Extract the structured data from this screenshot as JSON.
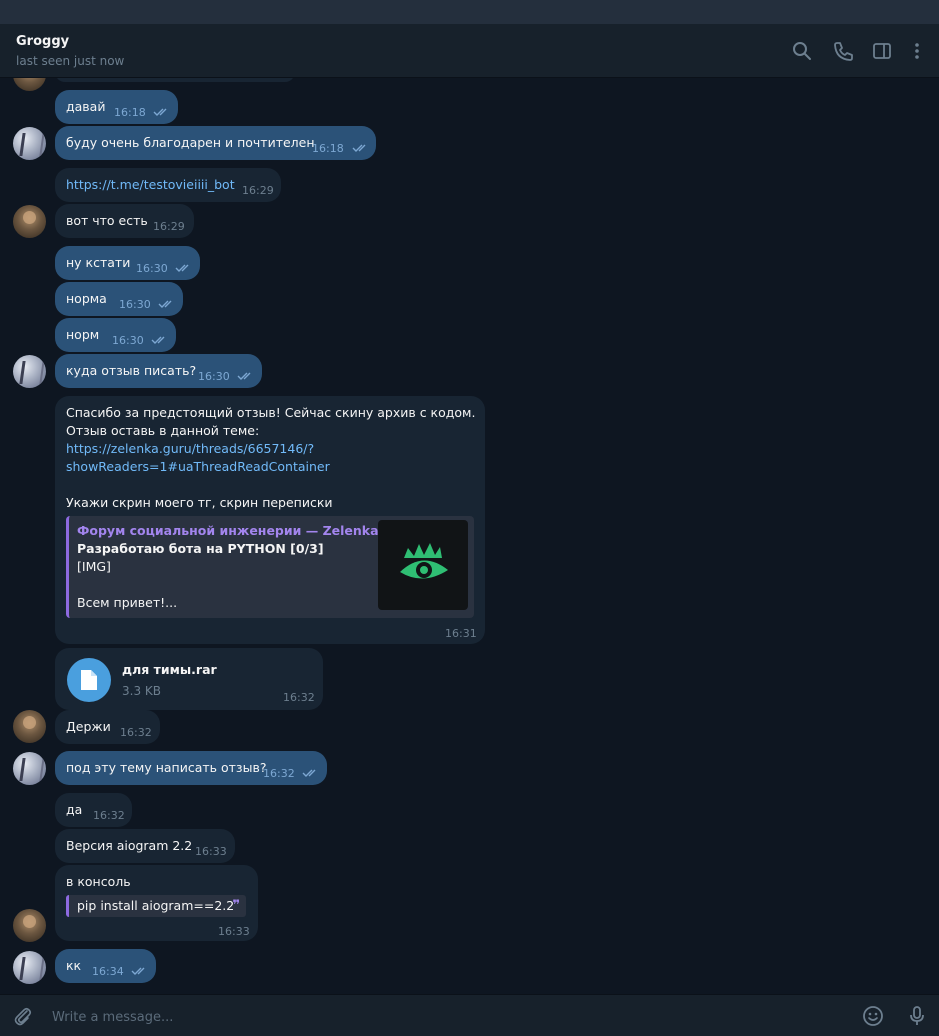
{
  "header": {
    "title": "Groggy",
    "status": "last seen just now",
    "icons": [
      "search-icon",
      "phone-icon",
      "sidebar-toggle-icon",
      "more-icon"
    ]
  },
  "messages": [
    {
      "dir": "out",
      "text": "давай",
      "time": "16:18",
      "read": true
    },
    {
      "dir": "out",
      "text": "буду очень благодарен и почтителен",
      "time": "16:18",
      "read": true
    },
    {
      "dir": "in",
      "text": "https://t.me/testovieiiii_bot",
      "time": "16:29"
    },
    {
      "dir": "in",
      "text": "вот что есть",
      "time": "16:29"
    },
    {
      "dir": "out",
      "text": "ну кстати",
      "time": "16:30",
      "read": true
    },
    {
      "dir": "out",
      "text": "норма",
      "time": "16:30",
      "read": true
    },
    {
      "dir": "out",
      "text": "норм",
      "time": "16:30",
      "read": true
    },
    {
      "dir": "out",
      "text": "куда отзыв писать?",
      "time": "16:30",
      "read": true
    },
    {
      "dir": "in",
      "lines": [
        "Спасибо за предстоящий отзыв! Сейчас скину архив с кодом.",
        "Отзыв оставь в данной теме:",
        "https://zelenka.guru/threads/6657146/?",
        "showReaders=1#uaThreadReadContainer",
        "Укажи скрин моего тг, скрин переписки"
      ],
      "preview": {
        "site": "Форум социальной инженерии — Zelenka....",
        "title": "Разработаю бота на PYTHON [0/3]",
        "img": "[IMG]",
        "body": "Всем привет!..."
      },
      "time": "16:31"
    },
    {
      "dir": "in",
      "file_name": "для тимы.rar",
      "file_size": "3.3 KB",
      "time": "16:32"
    },
    {
      "dir": "in",
      "text": "Держи",
      "time": "16:32"
    },
    {
      "dir": "out",
      "text": "под эту тему написать отзыв?",
      "time": "16:32",
      "read": true
    },
    {
      "dir": "in",
      "text": "да",
      "time": "16:32"
    },
    {
      "dir": "in",
      "text": "Версия aiogram 2.2",
      "time": "16:33"
    },
    {
      "dir": "in",
      "text": "в консоль",
      "code": "pip install aiogram==2.2",
      "time": "16:33"
    },
    {
      "dir": "out",
      "text": "кк",
      "time": "16:34",
      "read": true
    }
  ],
  "composer": {
    "placeholder": "Write a message...",
    "icons": [
      "attach-icon",
      "emoji-icon",
      "microphone-icon"
    ]
  },
  "colors": {
    "background": "#0e1621",
    "header": "#17212b",
    "outgoing_bubble": "#2b5278",
    "incoming_bubble": "#182533",
    "link": "#71baf9",
    "accent_purple": "#8d6ae0"
  }
}
